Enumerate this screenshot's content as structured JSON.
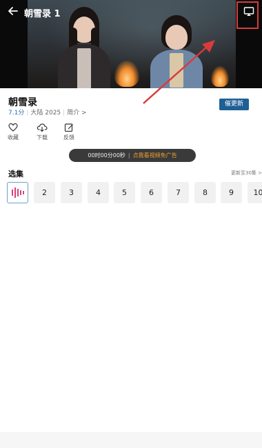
{
  "player": {
    "title": "朝雪录 1"
  },
  "info": {
    "title": "朝雪录",
    "score": "7.1分",
    "region_year": "大陆 2025",
    "intro_link": "简介 >",
    "update_button": "催更新"
  },
  "actions": [
    {
      "label": "收藏",
      "icon": "heart-icon"
    },
    {
      "label": "下载",
      "icon": "download-cloud-icon"
    },
    {
      "label": "反馈",
      "icon": "edit-icon"
    }
  ],
  "ad_bar": {
    "timer": "00时00分00秒",
    "link": "点我看视频免广告"
  },
  "episodes_section": {
    "title": "选集",
    "more": "更新至30集 >",
    "items": [
      "1",
      "2",
      "3",
      "4",
      "5",
      "6",
      "7",
      "8",
      "9",
      "10"
    ],
    "current": "1"
  },
  "colors": {
    "accent_blue": "#1e5f95",
    "highlight_red": "#d93b3b",
    "ad_link_orange": "#f0a030",
    "playing_bars": "#d6427a"
  }
}
